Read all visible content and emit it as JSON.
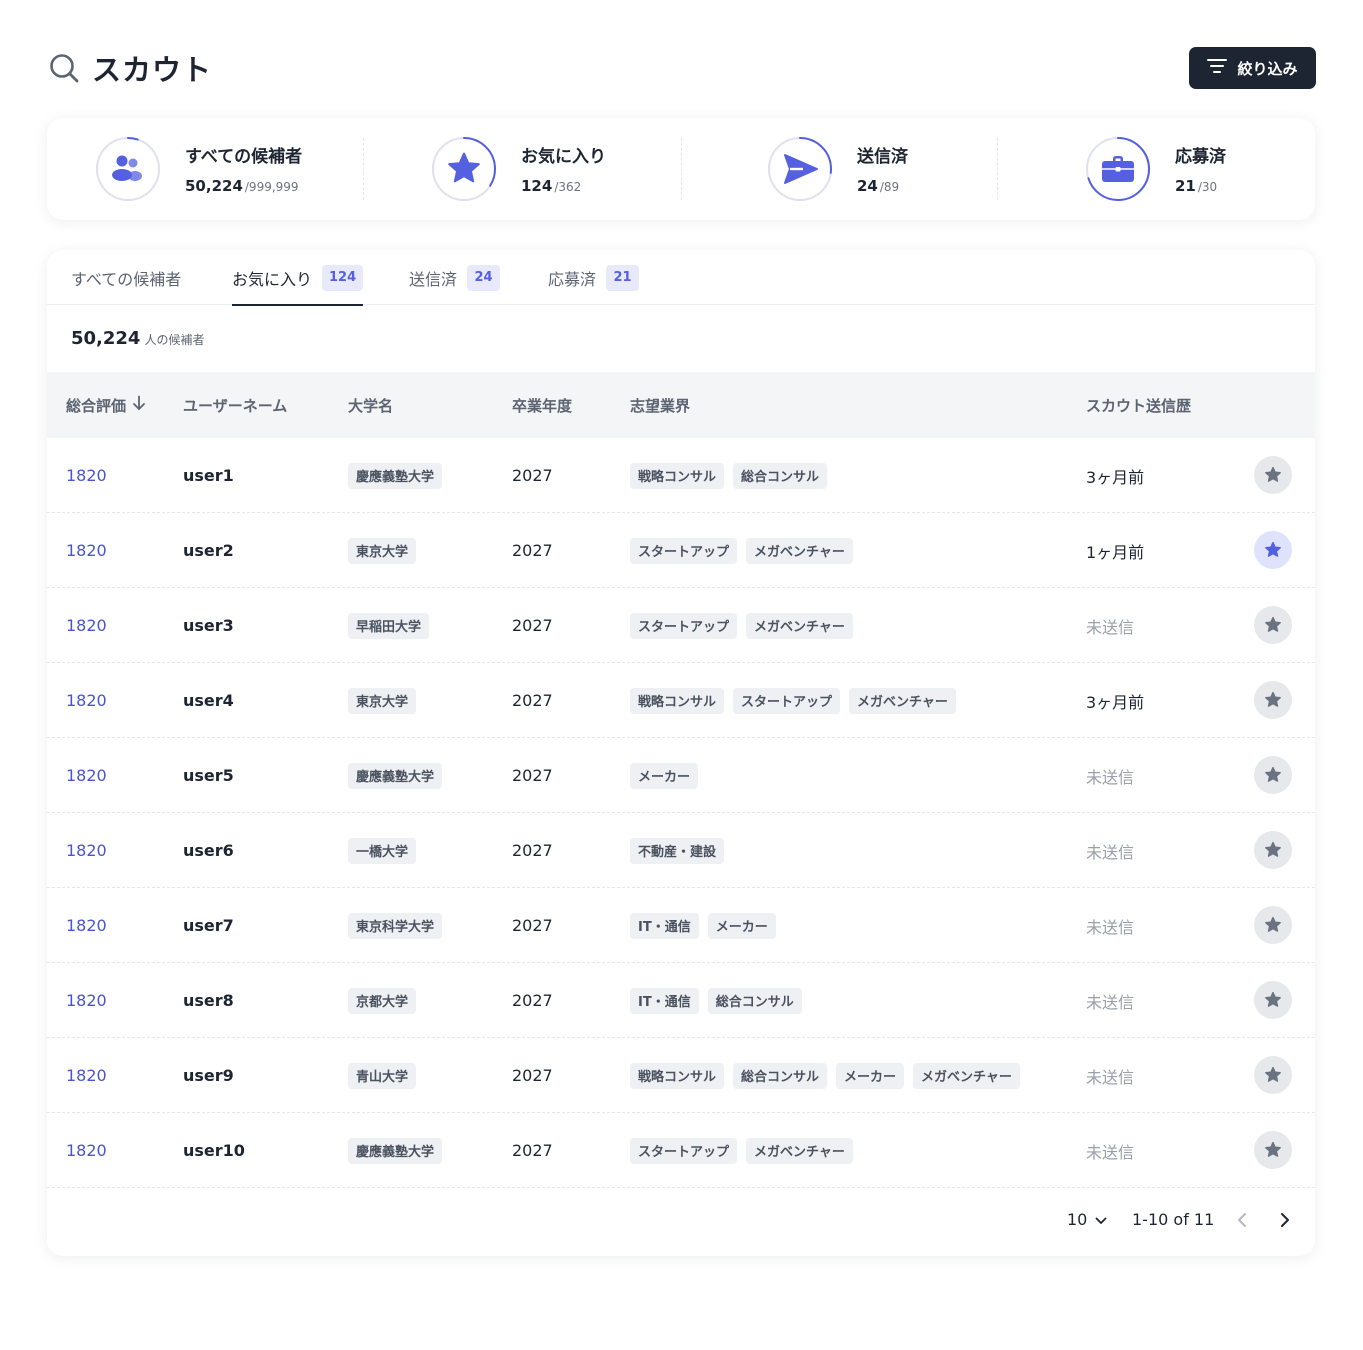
{
  "header": {
    "title": "スカウト",
    "search_icon": "search-icon",
    "filter_label": "絞り込み",
    "filter_icon": "filter-icon"
  },
  "stats": [
    {
      "label": "すべての候補者",
      "value": "50,224",
      "max": "/999,999",
      "icon": "users-icon",
      "progress": 0.05
    },
    {
      "label": "お気に入り",
      "value": "124",
      "max": "/362",
      "icon": "star-icon",
      "progress": 0.34
    },
    {
      "label": "送信済",
      "value": "24",
      "max": "/89",
      "icon": "send-icon",
      "progress": 0.27
    },
    {
      "label": "応募済",
      "value": "21",
      "max": "/30",
      "icon": "briefcase-icon",
      "progress": 0.7
    }
  ],
  "colors": {
    "accent": "#5560e0",
    "dark": "#1e2532",
    "muted": "#9aa0aa"
  },
  "tabs": [
    {
      "label": "すべての候補者",
      "badge": ""
    },
    {
      "label": "お気に入り",
      "badge": "124"
    },
    {
      "label": "送信済",
      "badge": "24"
    },
    {
      "label": "応募済",
      "badge": "21"
    }
  ],
  "active_tab": 1,
  "count": {
    "value": "50,224",
    "suffix": "人の候補者"
  },
  "table": {
    "columns": [
      "総合評価",
      "ユーザーネーム",
      "大学名",
      "卒業年度",
      "志望業界",
      "スカウト送信歴"
    ],
    "sort_icon": "arrow-down-icon",
    "rows": [
      {
        "score": "1820",
        "user": "user1",
        "univ": "慶應義塾大学",
        "year": "2027",
        "industries": [
          "戦略コンサル",
          "総合コンサル"
        ],
        "history": "3ヶ月前",
        "sent": true,
        "fav": false
      },
      {
        "score": "1820",
        "user": "user2",
        "univ": "東京大学",
        "year": "2027",
        "industries": [
          "スタートアップ",
          "メガベンチャー"
        ],
        "history": "1ヶ月前",
        "sent": true,
        "fav": true
      },
      {
        "score": "1820",
        "user": "user3",
        "univ": "早稲田大学",
        "year": "2027",
        "industries": [
          "スタートアップ",
          "メガベンチャー"
        ],
        "history": "未送信",
        "sent": false,
        "fav": false
      },
      {
        "score": "1820",
        "user": "user4",
        "univ": "東京大学",
        "year": "2027",
        "industries": [
          "戦略コンサル",
          "スタートアップ",
          "メガベンチャー"
        ],
        "history": "3ヶ月前",
        "sent": true,
        "fav": false
      },
      {
        "score": "1820",
        "user": "user5",
        "univ": "慶應義塾大学",
        "year": "2027",
        "industries": [
          "メーカー"
        ],
        "history": "未送信",
        "sent": false,
        "fav": false
      },
      {
        "score": "1820",
        "user": "user6",
        "univ": "一橋大学",
        "year": "2027",
        "industries": [
          "不動産・建設"
        ],
        "history": "未送信",
        "sent": false,
        "fav": false
      },
      {
        "score": "1820",
        "user": "user7",
        "univ": "東京科学大学",
        "year": "2027",
        "industries": [
          "IT・通信",
          "メーカー"
        ],
        "history": "未送信",
        "sent": false,
        "fav": false
      },
      {
        "score": "1820",
        "user": "user8",
        "univ": "京都大学",
        "year": "2027",
        "industries": [
          "IT・通信",
          "総合コンサル"
        ],
        "history": "未送信",
        "sent": false,
        "fav": false
      },
      {
        "score": "1820",
        "user": "user9",
        "univ": "青山大学",
        "year": "2027",
        "industries": [
          "戦略コンサル",
          "総合コンサル",
          "メーカー",
          "メガベンチャー"
        ],
        "history": "未送信",
        "sent": false,
        "fav": false
      },
      {
        "score": "1820",
        "user": "user10",
        "univ": "慶應義塾大学",
        "year": "2027",
        "industries": [
          "スタートアップ",
          "メガベンチャー"
        ],
        "history": "未送信",
        "sent": false,
        "fav": false
      }
    ]
  },
  "pagination": {
    "per_page": "10",
    "range": "1-10 of 11",
    "prev_icon": "chevron-left-icon",
    "next_icon": "chevron-right-icon"
  }
}
